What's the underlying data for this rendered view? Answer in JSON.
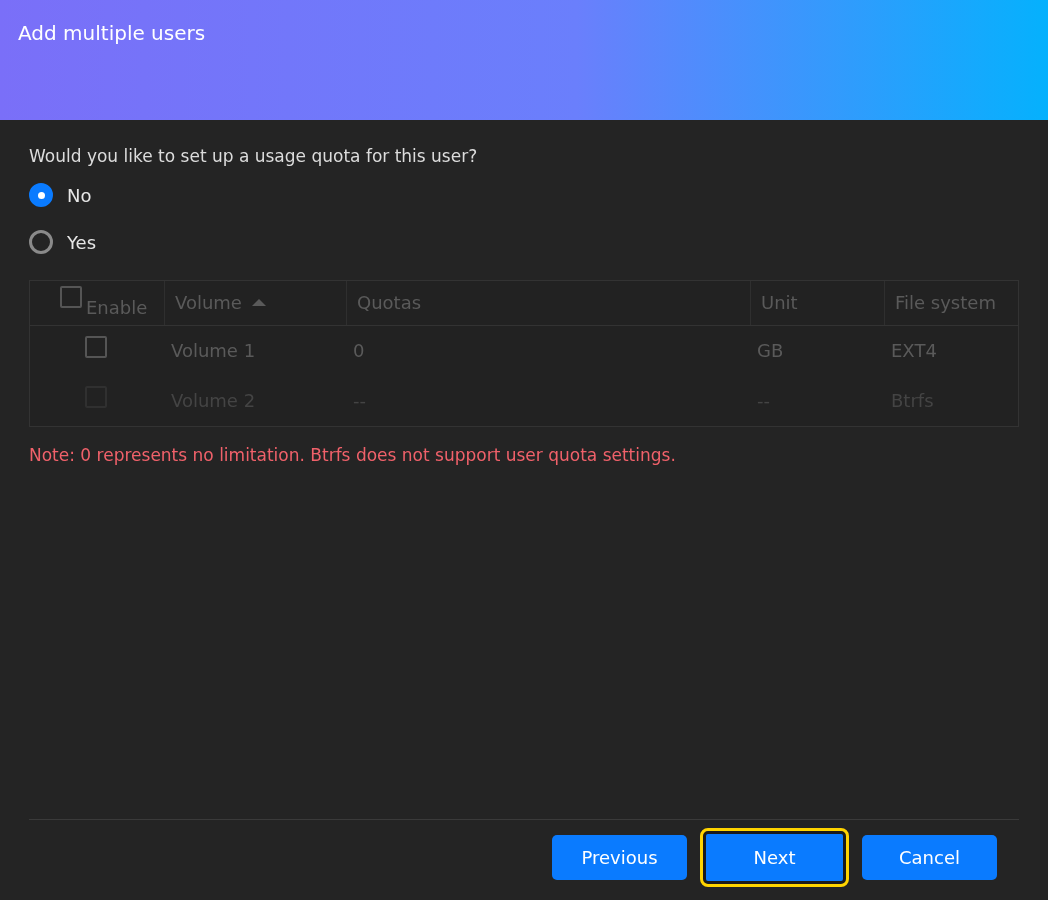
{
  "window": {
    "title": "Add multiple users"
  },
  "question": "Would you like to set up a usage quota for this user?",
  "options": [
    {
      "label": "No",
      "selected": true
    },
    {
      "label": "Yes",
      "selected": false
    }
  ],
  "table": {
    "disabled": true,
    "columns": [
      {
        "label": "Enable",
        "kind": "checkbox",
        "checked": false
      },
      {
        "label": "Volume",
        "kind": "sorted"
      },
      {
        "label": "Quotas",
        "kind": "text"
      },
      {
        "label": "Unit",
        "kind": "text"
      },
      {
        "label": "File system",
        "kind": "text"
      }
    ],
    "rows": [
      {
        "checked": false,
        "disabled": false,
        "cells": [
          "",
          "Volume 1",
          "0",
          "GB",
          "EXT4"
        ]
      },
      {
        "checked": false,
        "disabled": true,
        "cells": [
          "",
          "Volume 2",
          "--",
          "--",
          "Btrfs"
        ]
      }
    ]
  },
  "note": "Note: 0 represents no limitation. Btrfs does not support user quota settings.",
  "buttons": [
    {
      "label": "Previous",
      "focused": false
    },
    {
      "label": "Next",
      "focused": true
    },
    {
      "label": "Cancel",
      "focused": false
    }
  ]
}
